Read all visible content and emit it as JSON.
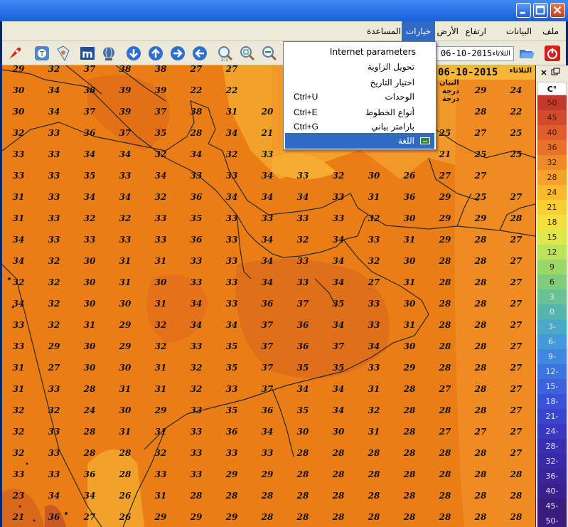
{
  "window": {
    "controls": [
      "minimize",
      "maximize",
      "close"
    ]
  },
  "menu": [
    "ملف",
    "البيانات",
    "ارتفاع",
    "الأرض",
    "خيارات",
    "المساعدة"
  ],
  "menu_active_index": 4,
  "toolbar": {
    "date": "06-10-2015",
    "weekday": "الثلاثاء"
  },
  "dropdown": {
    "items": [
      {
        "label": "Internet parameters",
        "shortcut": ""
      },
      {
        "label": "تحويل الزاوية",
        "shortcut": ""
      },
      {
        "label": "اختيار التاريخ",
        "shortcut": ""
      },
      {
        "label": "الوحدات",
        "shortcut": "Ctrl+U"
      },
      {
        "label": "أنواع الخطوط",
        "shortcut": "Ctrl+E"
      },
      {
        "label": "بارامتر بياني",
        "shortcut": "Ctrl+G"
      },
      {
        "label": "اللغة",
        "shortcut": "",
        "selected": true
      }
    ]
  },
  "map_overlay": {
    "date": "06-10-2015",
    "weekday": "الثلاثاء",
    "line2": "البيان",
    "line3": "درجة",
    "line4": "درجة"
  },
  "legend": {
    "unit": "C°",
    "colors": [
      "#c0392b",
      "#d24a2c",
      "#de5d2a",
      "#e7722a",
      "#ef8a2a",
      "#f5a12b",
      "#f8b92e",
      "#f7cf35",
      "#f2e03e",
      "#dde94b",
      "#bce25a",
      "#9bd86a",
      "#7fcc7d",
      "#68c295",
      "#56b6ae",
      "#4aa9c6",
      "#429ad8",
      "#3f88de",
      "#3d75df",
      "#3c63dc",
      "#3b52d6",
      "#3b44cc",
      "#3a38c0",
      "#3a2fb3",
      "#3a29a6",
      "#3a2499",
      "#3a208b",
      "#3a1c7d"
    ],
    "values": [
      "50",
      "45",
      "40",
      "36",
      "32",
      "28",
      "24",
      "21",
      "18",
      "15",
      "12",
      "9",
      "6",
      "3",
      "0",
      "3-",
      "6-",
      "9-",
      "12-",
      "15-",
      "18-",
      "21-",
      "24-",
      "28-",
      "32-",
      "36-",
      "40-",
      "45-",
      "50-"
    ]
  },
  "grid": {
    "rows": [
      [
        "29",
        "32",
        "37",
        "38",
        "38",
        "27",
        "27",
        "",
        "",
        "",
        "",
        "",
        "",
        "",
        ""
      ],
      [
        "30",
        "34",
        "38",
        "39",
        "39",
        "22",
        "22",
        "",
        "",
        "",
        "",
        "",
        "",
        "29",
        "24"
      ],
      [
        "30",
        "34",
        "37",
        "39",
        "37",
        "38",
        "31",
        "20",
        "",
        "",
        "",
        "",
        "",
        "28",
        "22"
      ],
      [
        "32",
        "33",
        "36",
        "37",
        "35",
        "28",
        "34",
        "21",
        "",
        "",
        "",
        "",
        "25",
        "27",
        "25"
      ],
      [
        "33",
        "33",
        "34",
        "34",
        "32",
        "34",
        "32",
        "33",
        "",
        "",
        "",
        "",
        "21",
        "25",
        "25"
      ],
      [
        "33",
        "33",
        "35",
        "33",
        "34",
        "33",
        "33",
        "34",
        "33",
        "32",
        "30",
        "26",
        "27",
        "27",
        ""
      ],
      [
        "31",
        "33",
        "34",
        "34",
        "32",
        "36",
        "34",
        "34",
        "34",
        "33",
        "31",
        "36",
        "29",
        "25",
        "27"
      ],
      [
        "31",
        "33",
        "32",
        "32",
        "33",
        "35",
        "33",
        "33",
        "33",
        "33",
        "32",
        "30",
        "29",
        "29",
        "28"
      ],
      [
        "34",
        "33",
        "33",
        "33",
        "33",
        "36",
        "33",
        "34",
        "32",
        "34",
        "33",
        "31",
        "29",
        "28",
        "27"
      ],
      [
        "34",
        "32",
        "30",
        "31",
        "31",
        "33",
        "33",
        "34",
        "33",
        "34",
        "32",
        "30",
        "28",
        "28",
        "27"
      ],
      [
        "32",
        "32",
        "30",
        "31",
        "30",
        "33",
        "33",
        "34",
        "33",
        "34",
        "27",
        "31",
        "28",
        "28",
        "27"
      ],
      [
        "34",
        "32",
        "30",
        "30",
        "31",
        "34",
        "33",
        "36",
        "37",
        "35",
        "33",
        "30",
        "28",
        "28",
        "27"
      ],
      [
        "33",
        "32",
        "31",
        "29",
        "32",
        "34",
        "34",
        "37",
        "36",
        "34",
        "33",
        "31",
        "28",
        "28",
        "27"
      ],
      [
        "33",
        "29",
        "30",
        "29",
        "32",
        "33",
        "35",
        "37",
        "36",
        "37",
        "34",
        "30",
        "28",
        "28",
        "27"
      ],
      [
        "31",
        "27",
        "30",
        "30",
        "31",
        "32",
        "35",
        "37",
        "35",
        "35",
        "33",
        "29",
        "28",
        "28",
        "27"
      ],
      [
        "31",
        "33",
        "28",
        "31",
        "31",
        "32",
        "33",
        "37",
        "34",
        "34",
        "31",
        "28",
        "27",
        "28",
        "27"
      ],
      [
        "32",
        "32",
        "24",
        "30",
        "29",
        "33",
        "35",
        "36",
        "35",
        "34",
        "32",
        "28",
        "28",
        "28",
        "27"
      ],
      [
        "32",
        "33",
        "28",
        "31",
        "31",
        "33",
        "36",
        "34",
        "30",
        "30",
        "31",
        "28",
        "27",
        "27",
        "27"
      ],
      [
        "32",
        "33",
        "28",
        "28",
        "32",
        "33",
        "33",
        "33",
        "28",
        "28",
        "28",
        "28",
        "28",
        "28",
        "27"
      ],
      [
        "33",
        "33",
        "36",
        "28",
        "33",
        "33",
        "29",
        "29",
        "28",
        "28",
        "28",
        "28",
        "28",
        "28",
        "28"
      ],
      [
        "23",
        "34",
        "34",
        "26",
        "31",
        "28",
        "28",
        "28",
        "28",
        "28",
        "28",
        "28",
        "28",
        "28",
        "28"
      ],
      [
        "21",
        "36",
        "27",
        "26",
        "29",
        "29",
        "29",
        "28",
        "28",
        "28",
        "28",
        "28",
        "28",
        "28",
        "28"
      ]
    ]
  }
}
